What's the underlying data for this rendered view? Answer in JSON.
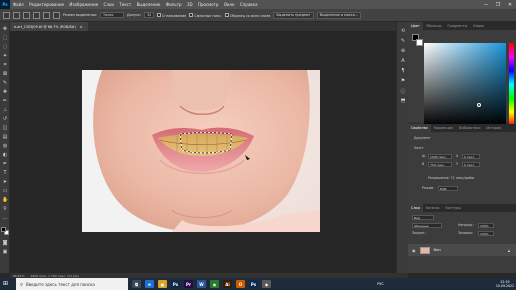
{
  "menu": {
    "logo": "Ps",
    "items": [
      "Файл",
      "Редактирование",
      "Изображение",
      "Слои",
      "Текст",
      "Выделение",
      "Фильтр",
      "3D",
      "Просмотр",
      "Окно",
      "Справка"
    ],
    "window_controls": [
      "—",
      "❐",
      "✕"
    ]
  },
  "options": {
    "mode_label": "Режим выделения:",
    "mode_value": "Точно",
    "distance_label": "Допуск:",
    "distance_value": "32",
    "antialias_label": "Сглаживание",
    "contiguous_label": "Смежные пикс.",
    "sample_all_label": "Образец со всех слоев",
    "select_subject_button": "Выделить предмет",
    "select_mask_button": "Выделение и маска..."
  },
  "document": {
    "tab_label": "e-art_1205J09.tif @ 66,7% (RGB/8#)",
    "close": "×"
  },
  "status": {
    "zoom": "66,67%",
    "size_info": "1000 пикс. x 750 пикс. (72 ppi)"
  },
  "panels": {
    "color_tabs": [
      "Цвет",
      "Образцы",
      "Градиенты",
      "Узоры"
    ],
    "props_tabs": [
      "Свойства",
      "Коррекция",
      "Библиотеки",
      "История"
    ],
    "document_label": "Документ",
    "canvas_label": "Холст",
    "width_label": "Ш",
    "width_value": "1000 пикс.",
    "height_label": "В",
    "height_value": "750 пикс.",
    "x_label": "X",
    "y_label": "Y",
    "x_value": "0 пикс.",
    "y_value": "0 пикс.",
    "resolution_label": "Разрешение: 72 пикс/дюйм",
    "mode_label": "Режим",
    "mode_value": "RGB",
    "layers_tabs": [
      "Слои",
      "Каналы",
      "Контуры"
    ],
    "kind_label": "Вид",
    "blend_mode": "Обычные",
    "opacity_label": "Непрозр.:",
    "opacity_value": "100%",
    "lock_label": "Закреп.:",
    "fill_label": "Заливка:",
    "fill_value": "100%",
    "layer_name": "Фон"
  },
  "taskbar": {
    "search_placeholder": "Введите здесь текст для поиска",
    "apps": [
      {
        "label": "⧉",
        "color": "#3a4a5a"
      },
      {
        "label": "e",
        "color": "#1e6fd0"
      },
      {
        "label": "▣",
        "color": "#d8a32a"
      },
      {
        "label": "Ps",
        "color": "#0b2a4a"
      },
      {
        "label": "Pr",
        "color": "#2a0b4a"
      },
      {
        "label": "W",
        "color": "#2b579a"
      },
      {
        "label": "◉",
        "color": "#2a7a2a"
      },
      {
        "label": "Ai",
        "color": "#3a1a00"
      },
      {
        "label": "O",
        "color": "#d05a00"
      },
      {
        "label": "Ps",
        "color": "#0b2a4a"
      },
      {
        "label": "◆",
        "color": "#5a5a5a"
      }
    ],
    "lang": "РУС",
    "time": "22:19",
    "date": "10.09.2022"
  }
}
